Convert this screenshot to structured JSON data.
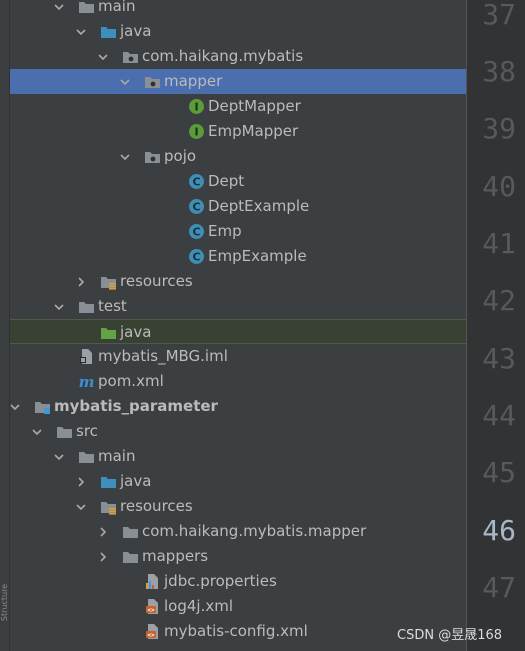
{
  "side_panel": {
    "label": "Structure"
  },
  "tree": {
    "rows": [
      {
        "label": "main",
        "icon": "folder-icon",
        "expanded": true
      },
      {
        "label": "java",
        "icon": "source-folder-icon",
        "expanded": true
      },
      {
        "label": "com.haikang.mybatis",
        "icon": "package-icon",
        "expanded": true
      },
      {
        "label": "mapper",
        "icon": "package-icon",
        "expanded": true,
        "selected": true
      },
      {
        "label": "DeptMapper",
        "icon": "interface-icon"
      },
      {
        "label": "EmpMapper",
        "icon": "interface-icon"
      },
      {
        "label": "pojo",
        "icon": "package-icon",
        "expanded": true
      },
      {
        "label": "Dept",
        "icon": "class-icon"
      },
      {
        "label": "DeptExample",
        "icon": "class-icon"
      },
      {
        "label": "Emp",
        "icon": "class-icon"
      },
      {
        "label": "EmpExample",
        "icon": "class-icon"
      },
      {
        "label": "resources",
        "icon": "resources-folder-icon",
        "expanded": false
      },
      {
        "label": "test",
        "icon": "folder-icon",
        "expanded": true
      },
      {
        "label": "java",
        "icon": "test-source-folder-icon",
        "highlighted": true
      },
      {
        "label": "mybatis_MBG.iml",
        "icon": "iml-file-icon"
      },
      {
        "label": "pom.xml",
        "icon": "maven-icon"
      },
      {
        "label": "mybatis_parameter",
        "icon": "module-icon",
        "expanded": true,
        "bold": true
      },
      {
        "label": "src",
        "icon": "folder-icon",
        "expanded": true
      },
      {
        "label": "main",
        "icon": "folder-icon",
        "expanded": true
      },
      {
        "label": "java",
        "icon": "source-folder-icon",
        "expanded": false
      },
      {
        "label": "resources",
        "icon": "resources-folder-icon",
        "expanded": true
      },
      {
        "label": "com.haikang.mybatis.mapper",
        "icon": "folder-icon",
        "expanded": false
      },
      {
        "label": "mappers",
        "icon": "folder-icon",
        "expanded": false
      },
      {
        "label": "jdbc.properties",
        "icon": "properties-file-icon"
      },
      {
        "label": "log4j.xml",
        "icon": "xml-file-icon"
      },
      {
        "label": "mybatis-config.xml",
        "icon": "xml-file-icon"
      }
    ]
  },
  "gutter": {
    "lines": [
      "37",
      "38",
      "39",
      "40",
      "41",
      "42",
      "43",
      "44",
      "45",
      "46",
      "47"
    ],
    "current": "46"
  },
  "watermark": {
    "text": "CSDN @昱晟168"
  }
}
